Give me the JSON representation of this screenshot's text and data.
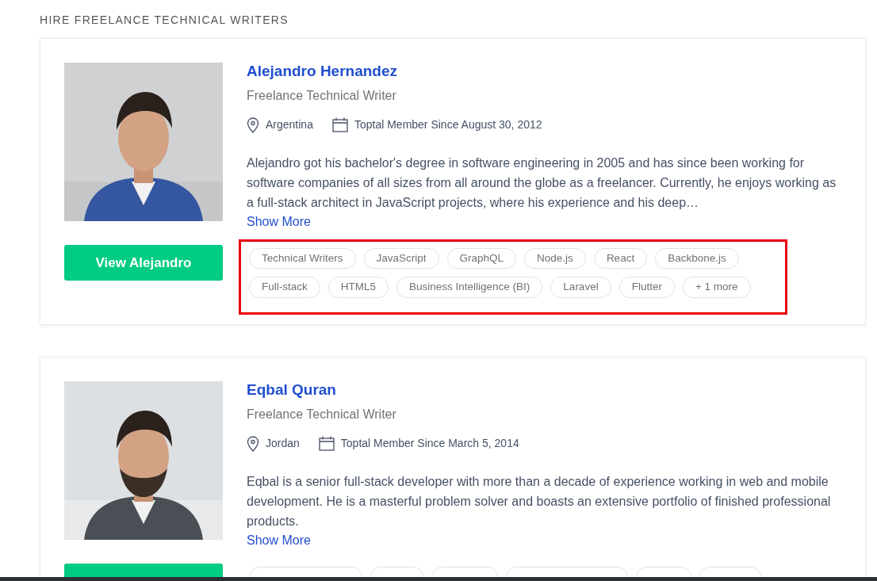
{
  "section_title": "HIRE FREELANCE TECHNICAL WRITERS",
  "profiles": [
    {
      "name": "Alejandro Hernandez",
      "role": "Freelance Technical Writer",
      "location": "Argentina",
      "member_since": "Toptal Member Since August 30, 2012",
      "bio": "Alejandro got his bachelor's degree in software engineering in 2005 and has since been working for software companies of all sizes from all around the globe as a freelancer. Currently, he enjoys working as a full-stack architect in JavaScript projects, where his experience and his deep…",
      "show_more": "Show More",
      "button": "View Alejandro",
      "skills_highlighted": true,
      "skills": [
        "Technical Writers",
        "JavaScript",
        "GraphQL",
        "Node.js",
        "React",
        "Backbone.js",
        "Full-stack",
        "HTML5",
        "Business Intelligence (BI)",
        "Laravel",
        "Flutter",
        "+ 1 more"
      ]
    },
    {
      "name": "Eqbal Quran",
      "role": "Freelance Technical Writer",
      "location": "Jordan",
      "member_since": "Toptal Member Since March 5, 2014",
      "bio": "Eqbal is a senior full-stack developer with more than a decade of experience working in web and mobile development. He is a masterful problem solver and boasts an extensive portfolio of finished professional products.",
      "show_more": "Show More",
      "cut_off": true
    }
  ]
}
